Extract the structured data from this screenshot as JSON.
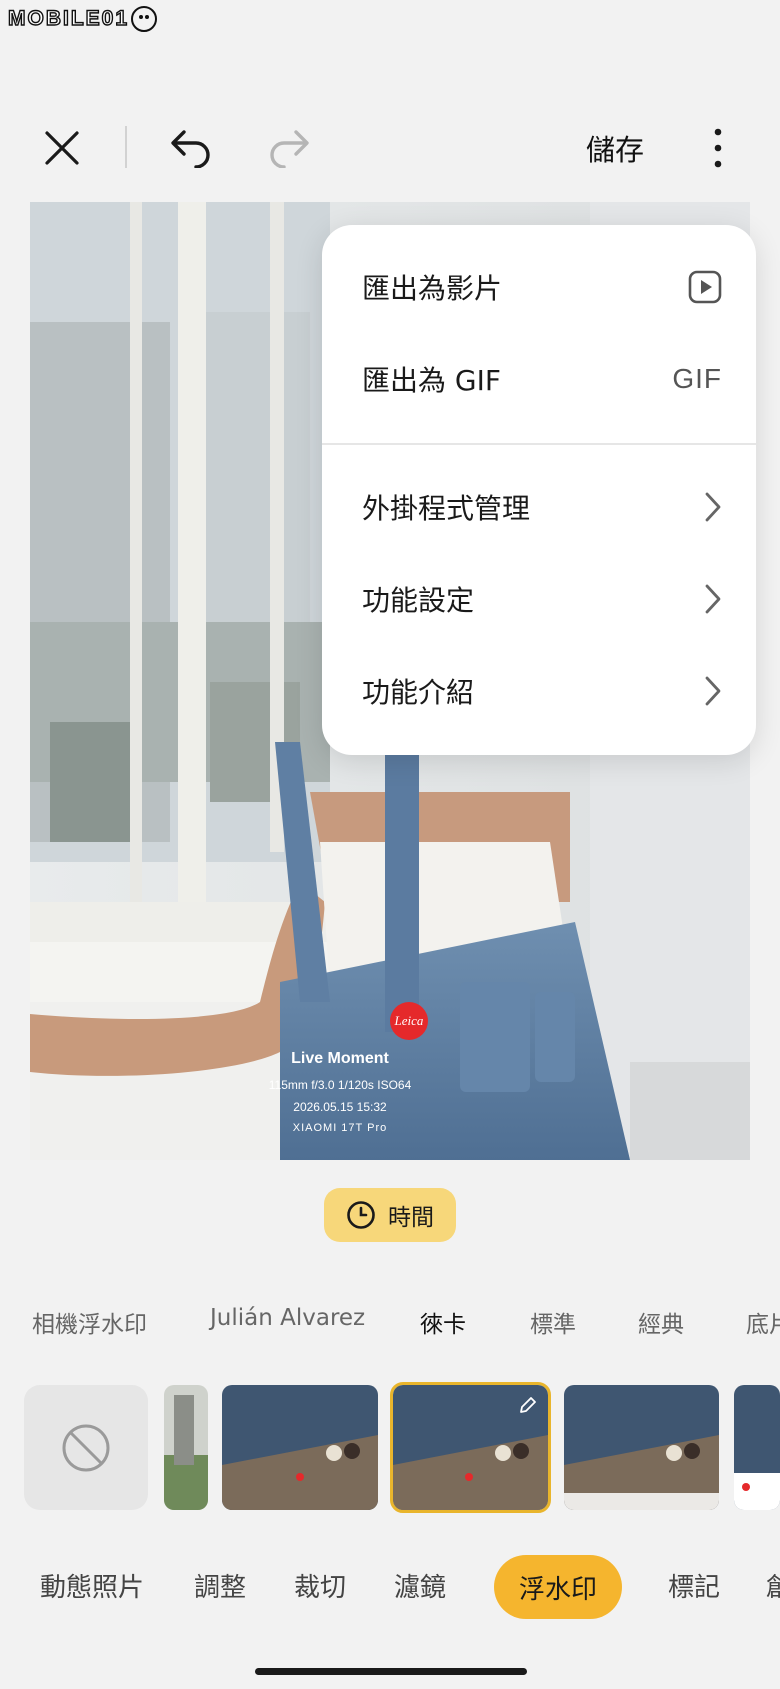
{
  "logo": {
    "text": "MOBILE01"
  },
  "toolbar": {
    "close_icon": "close-icon",
    "undo_icon": "undo-icon",
    "redo_icon": "redo-icon",
    "save_label": "儲存",
    "more_icon": "more-vertical-icon"
  },
  "watermark": {
    "brand": "Leica",
    "title": "Live Moment",
    "exif": "115mm  f/3.0  1/120s  ISO64",
    "datetime": "2026.05.15 15:32",
    "device": "XIAOMI 17T Pro"
  },
  "menu": {
    "items": [
      {
        "label": "匯出為影片",
        "icon": "play-video-icon"
      },
      {
        "label": "匯出為 GIF",
        "icon_text": "GIF"
      },
      {
        "label": "外掛程式管理",
        "icon": "chevron-right-icon"
      },
      {
        "label": "功能設定",
        "icon": "chevron-right-icon"
      },
      {
        "label": "功能介紹",
        "icon": "chevron-right-icon"
      }
    ]
  },
  "time_chip": {
    "label": "時間",
    "icon": "clock-icon"
  },
  "style_tabs": [
    {
      "label": "相機浮水印"
    },
    {
      "label": "Julián Alvarez"
    },
    {
      "label": "徠卡",
      "active": true
    },
    {
      "label": "標準"
    },
    {
      "label": "經典"
    },
    {
      "label": "底片"
    }
  ],
  "bottom_tabs": [
    {
      "label": "動態照片"
    },
    {
      "label": "調整"
    },
    {
      "label": "裁切"
    },
    {
      "label": "濾鏡"
    },
    {
      "label": "浮水印",
      "active": true
    },
    {
      "label": "標記"
    },
    {
      "label": "創"
    }
  ],
  "colors": {
    "accent": "#f5b52e",
    "chip": "#f7d77a",
    "leica_red": "#e5292b",
    "background": "#f2f2f2"
  }
}
